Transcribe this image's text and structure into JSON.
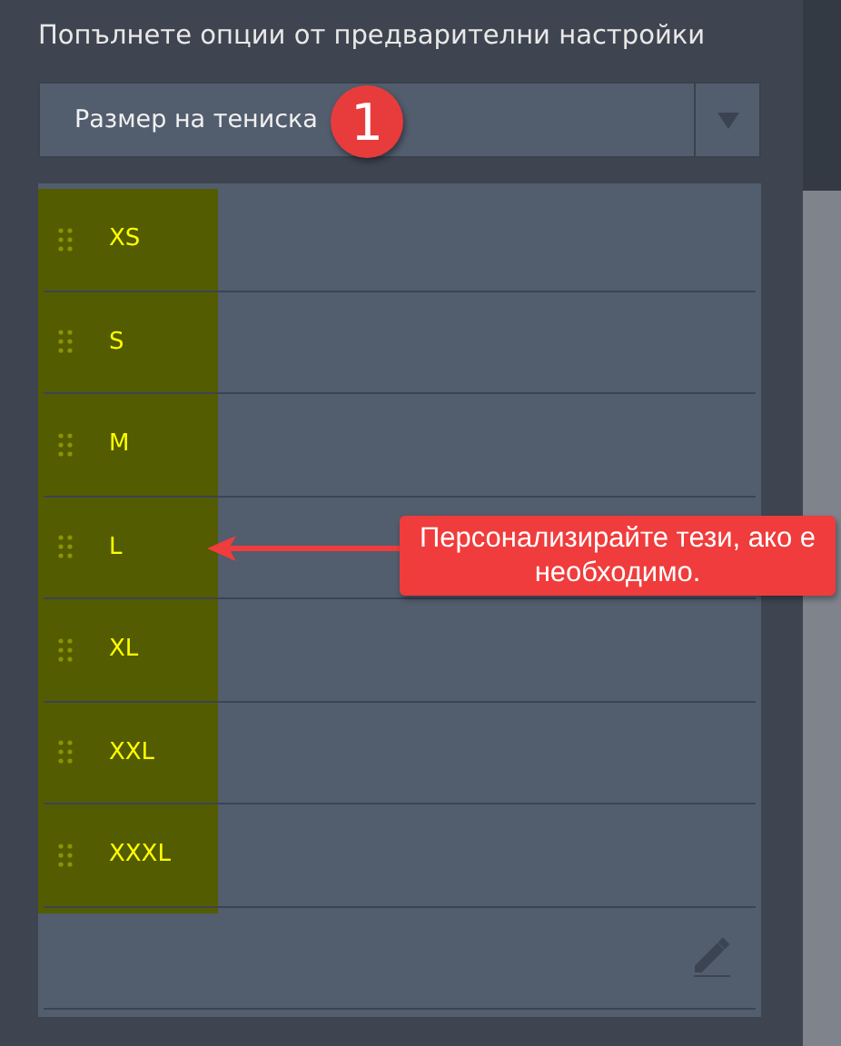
{
  "heading": "Попълнете опции от предварителни настройки",
  "preset_dropdown": {
    "value": "Размер на тениска"
  },
  "step_badge": "1",
  "options": [
    {
      "label": "XS"
    },
    {
      "label": "S"
    },
    {
      "label": "M"
    },
    {
      "label": "L"
    },
    {
      "label": "XL"
    },
    {
      "label": "XXL"
    },
    {
      "label": "XXXL"
    }
  ],
  "callout": {
    "text": "Персонализирайте тези, ако е необходимо."
  }
}
